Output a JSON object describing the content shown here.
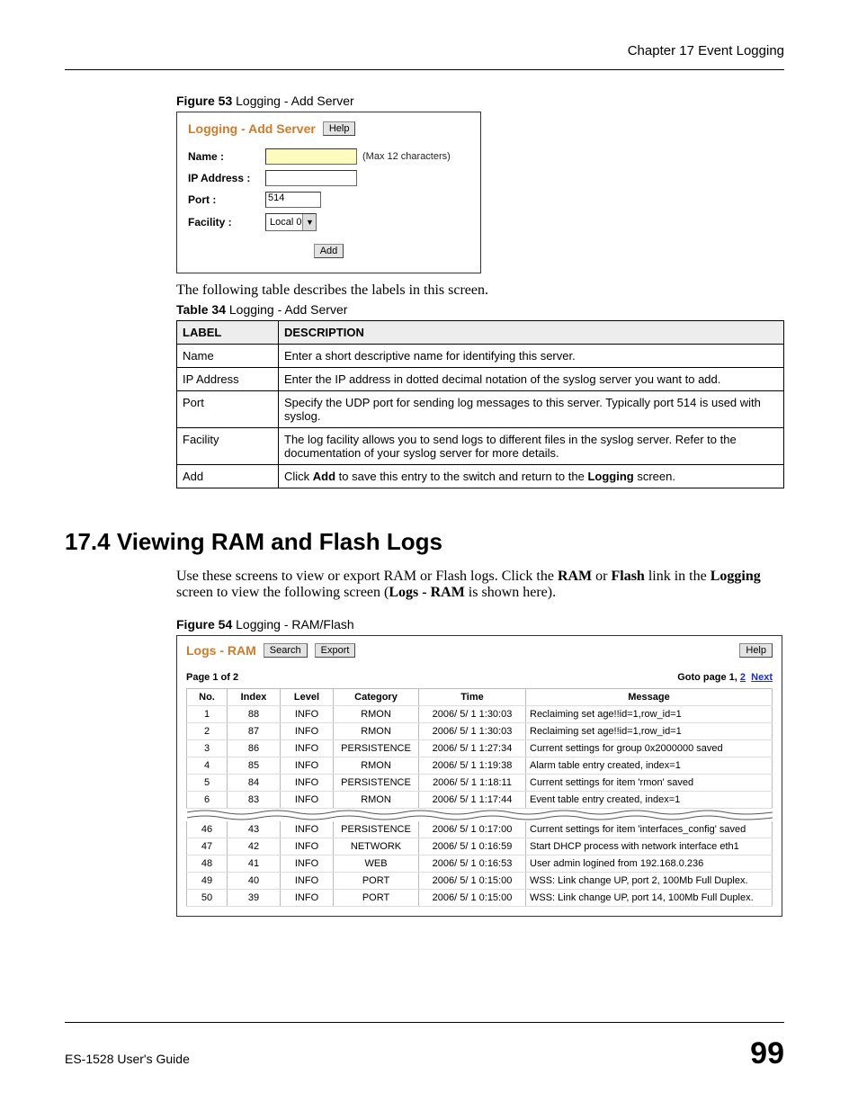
{
  "chapter_header": "Chapter 17 Event Logging",
  "figure53": {
    "caption_bold": "Figure 53",
    "caption_rest": "   Logging - Add Server",
    "panel_title": "Logging - Add Server",
    "help_btn": "Help",
    "rows": {
      "name_label": "Name :",
      "name_value": "",
      "name_hint": "(Max 12 characters)",
      "ip_label": "IP Address :",
      "ip_value": "",
      "port_label": "Port :",
      "port_value": "514",
      "facility_label": "Facility :",
      "facility_value": "Local 0"
    },
    "add_btn": "Add"
  },
  "para_after_fig53": "The following table describes the labels in this screen.",
  "table34": {
    "caption_bold": "Table 34",
    "caption_rest": "   Logging - Add Server",
    "head_label": "LABEL",
    "head_desc": "DESCRIPTION",
    "rows": [
      {
        "label": "Name",
        "desc": "Enter a short descriptive name for identifying this server."
      },
      {
        "label": "IP Address",
        "desc": "Enter the IP address in dotted decimal notation of the syslog server you want to add."
      },
      {
        "label": "Port",
        "desc": "Specify the UDP port for sending log messages to this server. Typically port 514 is used with syslog."
      },
      {
        "label": "Facility",
        "desc": "The log facility allows you to send logs to different files in the syslog server. Refer to the documentation of your syslog server for more details."
      },
      {
        "label": "Add",
        "desc_html": "Click <b>Add</b> to save this entry to the switch and return to the <b>Logging</b> screen."
      }
    ]
  },
  "section_heading": "17.4  Viewing RAM and Flash Logs",
  "section_para_html": "Use these screens to view or export RAM or Flash logs. Click the <b>RAM</b> or <b>Flash</b> link in the <b>Logging</b> screen to view the following screen (<b>Logs - RAM</b> is shown here).",
  "figure54": {
    "caption_bold": "Figure 54",
    "caption_rest": "   Logging - RAM/Flash",
    "panel_title": "Logs - RAM",
    "search_btn": "Search",
    "export_btn": "Export",
    "help_btn": "Help",
    "page_left": "Page 1 of 2",
    "goto_prefix": "Goto page  1, ",
    "goto_link2": "2",
    "goto_next": "Next",
    "columns": [
      "No.",
      "Index",
      "Level",
      "Category",
      "Time",
      "Message"
    ],
    "rows_top": [
      {
        "no": "1",
        "index": "88",
        "level": "INFO",
        "cat": "RMON",
        "time": "2006/ 5/ 1 1:30:03",
        "msg": "Reclaiming set age!!id=1,row_id=1"
      },
      {
        "no": "2",
        "index": "87",
        "level": "INFO",
        "cat": "RMON",
        "time": "2006/ 5/ 1 1:30:03",
        "msg": "Reclaiming set age!!id=1,row_id=1"
      },
      {
        "no": "3",
        "index": "86",
        "level": "INFO",
        "cat": "PERSISTENCE",
        "time": "2006/ 5/ 1 1:27:34",
        "msg": "Current settings for group 0x2000000 saved"
      },
      {
        "no": "4",
        "index": "85",
        "level": "INFO",
        "cat": "RMON",
        "time": "2006/ 5/ 1 1:19:38",
        "msg": "Alarm table entry created, index=1"
      },
      {
        "no": "5",
        "index": "84",
        "level": "INFO",
        "cat": "PERSISTENCE",
        "time": "2006/ 5/ 1 1:18:11",
        "msg": "Current settings for item 'rmon' saved"
      },
      {
        "no": "6",
        "index": "83",
        "level": "INFO",
        "cat": "RMON",
        "time": "2006/ 5/ 1 1:17:44",
        "msg": "Event table entry created, index=1"
      }
    ],
    "rows_bottom": [
      {
        "no": "46",
        "index": "43",
        "level": "INFO",
        "cat": "PERSISTENCE",
        "time": "2006/ 5/ 1 0:17:00",
        "msg": "Current settings for item 'interfaces_config' saved"
      },
      {
        "no": "47",
        "index": "42",
        "level": "INFO",
        "cat": "NETWORK",
        "time": "2006/ 5/ 1 0:16:59",
        "msg": "Start DHCP process with network interface eth1"
      },
      {
        "no": "48",
        "index": "41",
        "level": "INFO",
        "cat": "WEB",
        "time": "2006/ 5/ 1 0:16:53",
        "msg": "User admin logined from 192.168.0.236"
      },
      {
        "no": "49",
        "index": "40",
        "level": "INFO",
        "cat": "PORT",
        "time": "2006/ 5/ 1 0:15:00",
        "msg": "WSS: Link change UP, port 2, 100Mb Full Duplex."
      },
      {
        "no": "50",
        "index": "39",
        "level": "INFO",
        "cat": "PORT",
        "time": "2006/ 5/ 1 0:15:00",
        "msg": "WSS: Link change UP, port 14, 100Mb Full Duplex."
      }
    ]
  },
  "footer_guide": "ES-1528 User's Guide",
  "footer_page": "99"
}
